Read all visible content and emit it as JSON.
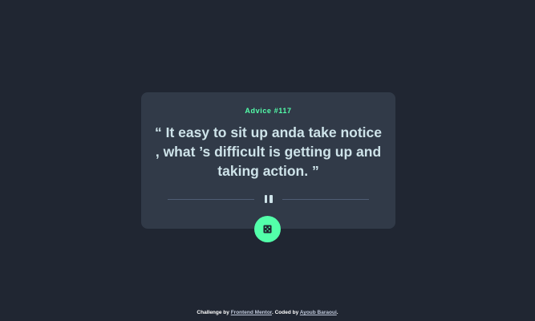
{
  "colors": {
    "background": "#202632",
    "card": "#313a48",
    "accent": "#53ffaa",
    "quote_text": "#cee3e9",
    "divider": "#4f5d74"
  },
  "card": {
    "advice_label": "Advice #117",
    "quote": "“ It easy to sit up anda take notice , what ’s difficult is getting up and taking action. ”"
  },
  "icons": {
    "divider": "pause-icon",
    "button": "dice-icon"
  },
  "footer": {
    "prefix": "Challenge by ",
    "challenge_link": "Frontend Mentor",
    "middle": ". Coded by ",
    "author_link": "Ayoub Baraoui",
    "suffix": "."
  }
}
